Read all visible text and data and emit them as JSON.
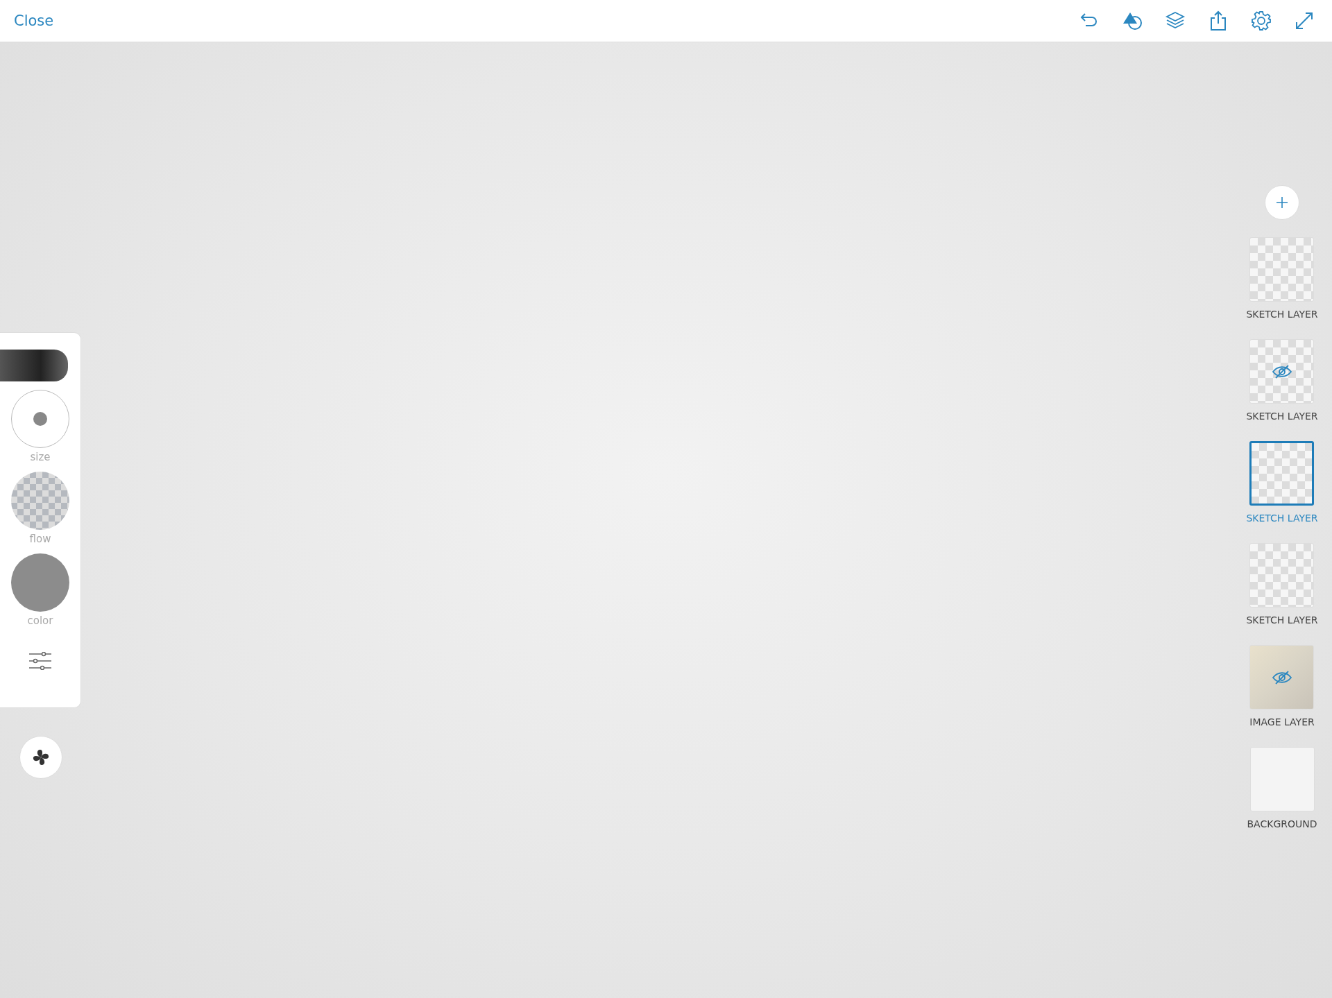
{
  "top_bar": {
    "close": "Close"
  },
  "brush_panel": {
    "controls": [
      {
        "kind": "size",
        "label": "size"
      },
      {
        "kind": "flow",
        "label": "flow"
      },
      {
        "kind": "color",
        "label": "color",
        "color": "#8c8c8c"
      }
    ]
  },
  "layers": [
    {
      "label": "SKETCH LAYER",
      "kind": "sketch",
      "selected": false,
      "hidden": false
    },
    {
      "label": "SKETCH LAYER",
      "kind": "sketch",
      "selected": false,
      "hidden": true
    },
    {
      "label": "SKETCH LAYER",
      "kind": "sketch",
      "selected": true,
      "hidden": false
    },
    {
      "label": "SKETCH LAYER",
      "kind": "sketch",
      "selected": false,
      "hidden": false
    },
    {
      "label": "IMAGE LAYER",
      "kind": "image",
      "selected": false,
      "hidden": true
    },
    {
      "label": "BACKGROUND",
      "kind": "background",
      "selected": false,
      "hidden": false
    }
  ]
}
